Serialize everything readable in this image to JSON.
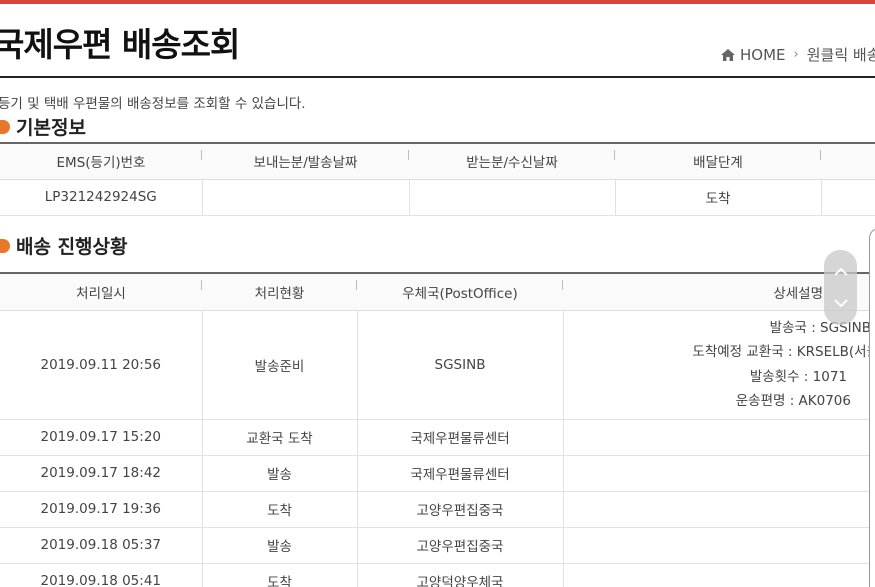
{
  "header": {
    "title": "국제우편 배송조회",
    "breadcrumb": {
      "home": "HOME",
      "current": "원클릭 배송조"
    }
  },
  "intro_text": "등기 및 택배 우편물의 배송정보를 조회할 수 있습니다.",
  "basic_info": {
    "section_title": "기본정보",
    "columns": [
      "EMS(등기)번호",
      "보내는분/발송날짜",
      "받는분/수신날짜",
      "배달단계"
    ],
    "row": [
      "LP321242924SG",
      "",
      "",
      "도착"
    ]
  },
  "progress": {
    "section_title": "배송 진행상황",
    "columns": [
      "처리일시",
      "처리현황",
      "우체국(PostOffice)",
      "상세설명"
    ],
    "rows": [
      {
        "datetime": "2019.09.11 20:56",
        "status": "발송준비",
        "office": "SGSINB",
        "detail": [
          "발송국 : SGSINB",
          "도착예정 교환국 : KRSELB(서울",
          "발송횟수 : 1071",
          "운송편명 : AK0706"
        ]
      },
      {
        "datetime": "2019.09.17 15:20",
        "status": "교환국 도착",
        "office": "국제우편물류센터",
        "detail": []
      },
      {
        "datetime": "2019.09.17 18:42",
        "status": "발송",
        "office": "국제우편물류센터",
        "detail": []
      },
      {
        "datetime": "2019.09.17 19:36",
        "status": "도착",
        "office": "고양우편집중국",
        "detail": []
      },
      {
        "datetime": "2019.09.18 05:37",
        "status": "발송",
        "office": "고양우편집중국",
        "detail": []
      },
      {
        "datetime": "2019.09.18 05:41",
        "status": "도착",
        "office": "고양덕양우체국",
        "detail": []
      }
    ]
  },
  "icons": {
    "home": "home-icon",
    "separator": "chevron-right-icon",
    "scroll_up": "chevron-up-icon",
    "scroll_down": "chevron-down-icon"
  },
  "colors": {
    "accent_top_line": "#d9453b",
    "section_bullet": "#e8762b"
  }
}
